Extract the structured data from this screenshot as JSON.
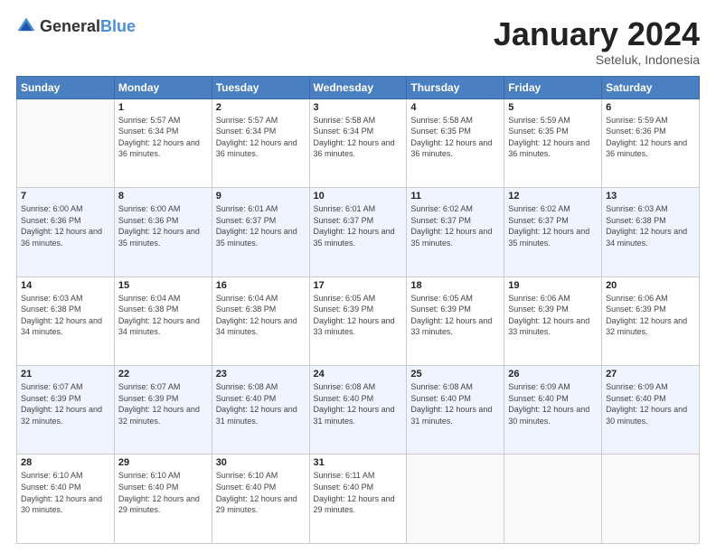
{
  "header": {
    "logo_general": "General",
    "logo_blue": "Blue",
    "month_title": "January 2024",
    "subtitle": "Seteluk, Indonesia"
  },
  "days_of_week": [
    "Sunday",
    "Monday",
    "Tuesday",
    "Wednesday",
    "Thursday",
    "Friday",
    "Saturday"
  ],
  "weeks": [
    [
      {
        "day": "",
        "sunrise": "",
        "sunset": "",
        "daylight": ""
      },
      {
        "day": "1",
        "sunrise": "Sunrise: 5:57 AM",
        "sunset": "Sunset: 6:34 PM",
        "daylight": "Daylight: 12 hours and 36 minutes."
      },
      {
        "day": "2",
        "sunrise": "Sunrise: 5:57 AM",
        "sunset": "Sunset: 6:34 PM",
        "daylight": "Daylight: 12 hours and 36 minutes."
      },
      {
        "day": "3",
        "sunrise": "Sunrise: 5:58 AM",
        "sunset": "Sunset: 6:34 PM",
        "daylight": "Daylight: 12 hours and 36 minutes."
      },
      {
        "day": "4",
        "sunrise": "Sunrise: 5:58 AM",
        "sunset": "Sunset: 6:35 PM",
        "daylight": "Daylight: 12 hours and 36 minutes."
      },
      {
        "day": "5",
        "sunrise": "Sunrise: 5:59 AM",
        "sunset": "Sunset: 6:35 PM",
        "daylight": "Daylight: 12 hours and 36 minutes."
      },
      {
        "day": "6",
        "sunrise": "Sunrise: 5:59 AM",
        "sunset": "Sunset: 6:36 PM",
        "daylight": "Daylight: 12 hours and 36 minutes."
      }
    ],
    [
      {
        "day": "7",
        "sunrise": "Sunrise: 6:00 AM",
        "sunset": "Sunset: 6:36 PM",
        "daylight": "Daylight: 12 hours and 36 minutes."
      },
      {
        "day": "8",
        "sunrise": "Sunrise: 6:00 AM",
        "sunset": "Sunset: 6:36 PM",
        "daylight": "Daylight: 12 hours and 35 minutes."
      },
      {
        "day": "9",
        "sunrise": "Sunrise: 6:01 AM",
        "sunset": "Sunset: 6:37 PM",
        "daylight": "Daylight: 12 hours and 35 minutes."
      },
      {
        "day": "10",
        "sunrise": "Sunrise: 6:01 AM",
        "sunset": "Sunset: 6:37 PM",
        "daylight": "Daylight: 12 hours and 35 minutes."
      },
      {
        "day": "11",
        "sunrise": "Sunrise: 6:02 AM",
        "sunset": "Sunset: 6:37 PM",
        "daylight": "Daylight: 12 hours and 35 minutes."
      },
      {
        "day": "12",
        "sunrise": "Sunrise: 6:02 AM",
        "sunset": "Sunset: 6:37 PM",
        "daylight": "Daylight: 12 hours and 35 minutes."
      },
      {
        "day": "13",
        "sunrise": "Sunrise: 6:03 AM",
        "sunset": "Sunset: 6:38 PM",
        "daylight": "Daylight: 12 hours and 34 minutes."
      }
    ],
    [
      {
        "day": "14",
        "sunrise": "Sunrise: 6:03 AM",
        "sunset": "Sunset: 6:38 PM",
        "daylight": "Daylight: 12 hours and 34 minutes."
      },
      {
        "day": "15",
        "sunrise": "Sunrise: 6:04 AM",
        "sunset": "Sunset: 6:38 PM",
        "daylight": "Daylight: 12 hours and 34 minutes."
      },
      {
        "day": "16",
        "sunrise": "Sunrise: 6:04 AM",
        "sunset": "Sunset: 6:38 PM",
        "daylight": "Daylight: 12 hours and 34 minutes."
      },
      {
        "day": "17",
        "sunrise": "Sunrise: 6:05 AM",
        "sunset": "Sunset: 6:39 PM",
        "daylight": "Daylight: 12 hours and 33 minutes."
      },
      {
        "day": "18",
        "sunrise": "Sunrise: 6:05 AM",
        "sunset": "Sunset: 6:39 PM",
        "daylight": "Daylight: 12 hours and 33 minutes."
      },
      {
        "day": "19",
        "sunrise": "Sunrise: 6:06 AM",
        "sunset": "Sunset: 6:39 PM",
        "daylight": "Daylight: 12 hours and 33 minutes."
      },
      {
        "day": "20",
        "sunrise": "Sunrise: 6:06 AM",
        "sunset": "Sunset: 6:39 PM",
        "daylight": "Daylight: 12 hours and 32 minutes."
      }
    ],
    [
      {
        "day": "21",
        "sunrise": "Sunrise: 6:07 AM",
        "sunset": "Sunset: 6:39 PM",
        "daylight": "Daylight: 12 hours and 32 minutes."
      },
      {
        "day": "22",
        "sunrise": "Sunrise: 6:07 AM",
        "sunset": "Sunset: 6:39 PM",
        "daylight": "Daylight: 12 hours and 32 minutes."
      },
      {
        "day": "23",
        "sunrise": "Sunrise: 6:08 AM",
        "sunset": "Sunset: 6:40 PM",
        "daylight": "Daylight: 12 hours and 31 minutes."
      },
      {
        "day": "24",
        "sunrise": "Sunrise: 6:08 AM",
        "sunset": "Sunset: 6:40 PM",
        "daylight": "Daylight: 12 hours and 31 minutes."
      },
      {
        "day": "25",
        "sunrise": "Sunrise: 6:08 AM",
        "sunset": "Sunset: 6:40 PM",
        "daylight": "Daylight: 12 hours and 31 minutes."
      },
      {
        "day": "26",
        "sunrise": "Sunrise: 6:09 AM",
        "sunset": "Sunset: 6:40 PM",
        "daylight": "Daylight: 12 hours and 30 minutes."
      },
      {
        "day": "27",
        "sunrise": "Sunrise: 6:09 AM",
        "sunset": "Sunset: 6:40 PM",
        "daylight": "Daylight: 12 hours and 30 minutes."
      }
    ],
    [
      {
        "day": "28",
        "sunrise": "Sunrise: 6:10 AM",
        "sunset": "Sunset: 6:40 PM",
        "daylight": "Daylight: 12 hours and 30 minutes."
      },
      {
        "day": "29",
        "sunrise": "Sunrise: 6:10 AM",
        "sunset": "Sunset: 6:40 PM",
        "daylight": "Daylight: 12 hours and 29 minutes."
      },
      {
        "day": "30",
        "sunrise": "Sunrise: 6:10 AM",
        "sunset": "Sunset: 6:40 PM",
        "daylight": "Daylight: 12 hours and 29 minutes."
      },
      {
        "day": "31",
        "sunrise": "Sunrise: 6:11 AM",
        "sunset": "Sunset: 6:40 PM",
        "daylight": "Daylight: 12 hours and 29 minutes."
      },
      {
        "day": "",
        "sunrise": "",
        "sunset": "",
        "daylight": ""
      },
      {
        "day": "",
        "sunrise": "",
        "sunset": "",
        "daylight": ""
      },
      {
        "day": "",
        "sunrise": "",
        "sunset": "",
        "daylight": ""
      }
    ]
  ]
}
